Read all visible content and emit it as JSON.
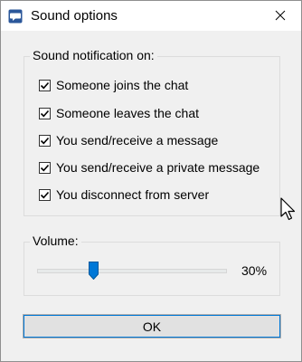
{
  "window": {
    "title": "Sound options",
    "icon": "chat-bubble-icon",
    "close_icon": "close-icon"
  },
  "notifications": {
    "legend": "Sound notification on:",
    "items": [
      {
        "label": "Someone joins the chat",
        "checked": true
      },
      {
        "label": "Someone leaves the chat",
        "checked": true
      },
      {
        "label": "You send/receive a message",
        "checked": true
      },
      {
        "label": "You send/receive a private message",
        "checked": true
      },
      {
        "label": "You disconnect from server",
        "checked": true
      }
    ]
  },
  "volume": {
    "legend": "Volume:",
    "value_text": "30%",
    "value": 30,
    "accent_color": "#0078d7"
  },
  "buttons": {
    "ok_label": "OK"
  }
}
